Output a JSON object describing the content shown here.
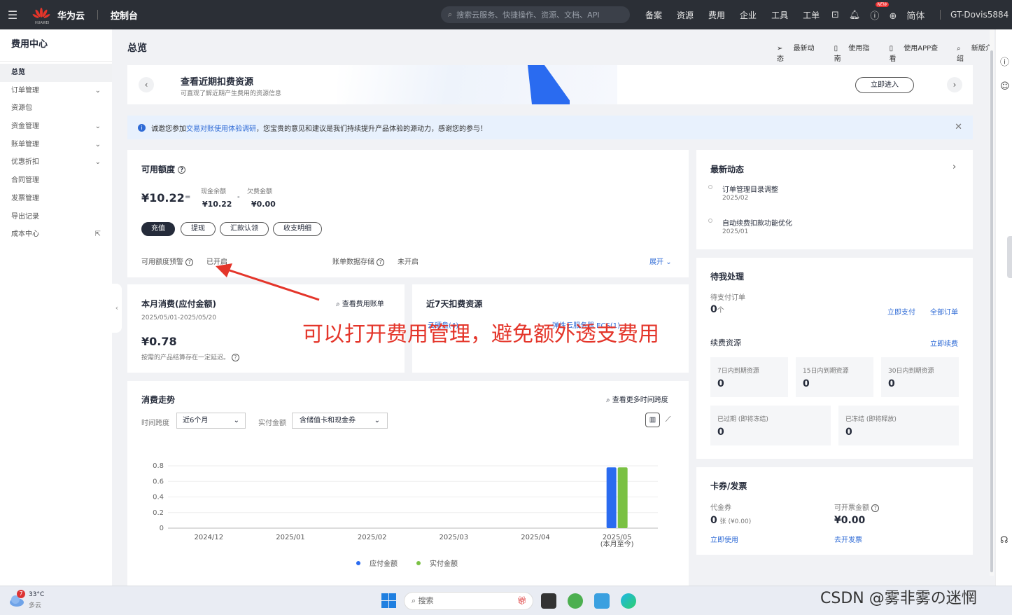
{
  "topbar": {
    "menu_icon": "hamburger-icon",
    "brand": "华为云",
    "brand_sub": "HUAWEI",
    "console": "控制台",
    "search_placeholder": "搜索云服务、快捷操作、资源、文档、API",
    "nav": [
      "备案",
      "资源",
      "费用",
      "企业",
      "工具",
      "工单"
    ],
    "new_badge": "NEW",
    "lang": "简体",
    "user": "GT-Dovis5884",
    "brand_color": "#e4352a"
  },
  "sidebar": {
    "title": "费用中心",
    "items": [
      {
        "label": "总览",
        "active": true,
        "expand": false
      },
      {
        "label": "订单管理",
        "expand": true
      },
      {
        "label": "资源包",
        "expand": false
      },
      {
        "label": "资金管理",
        "expand": true
      },
      {
        "label": "账单管理",
        "expand": true
      },
      {
        "label": "优惠折扣",
        "expand": true
      },
      {
        "label": "合同管理",
        "expand": false
      },
      {
        "label": "发票管理",
        "expand": false
      },
      {
        "label": "导出记录",
        "expand": false
      },
      {
        "label": "成本中心",
        "expand": false,
        "external": true
      }
    ]
  },
  "page": {
    "title": "总览",
    "top_links": [
      "最新动态",
      "使用指南",
      "使用APP查看",
      "新版介绍"
    ]
  },
  "banner": {
    "title": "查看近期扣费资源",
    "subtitle": "可直观了解近期产生费用的资源信息",
    "enter": "立即进入"
  },
  "notice": {
    "prefix": "诚邀您参加",
    "link": "交易对账使用体验调研",
    "suffix": "，您宝贵的意见和建议是我们持续提升产品体验的源动力，感谢您的参与！"
  },
  "balance": {
    "title": "可用额度",
    "amount": "¥10.22",
    "eq": "=",
    "minus": "-",
    "cash_label": "现金余额",
    "cash": "¥10.22",
    "debt_label": "欠费金额",
    "debt": "¥0.00",
    "buttons": [
      "充值",
      "提现",
      "汇款认领",
      "收支明细"
    ],
    "alert_label": "可用额度预警",
    "alert_status": "已开启",
    "storage_label": "账单数据存储",
    "storage_status": "未开启",
    "expand": "展开"
  },
  "monthly": {
    "title": "本月消费(应付金额)",
    "link": "查看费用账单",
    "period": "2025/05/01-2025/05/20",
    "amount": "¥0.78",
    "note": "按需的产品结算存在一定延迟。"
  },
  "recent7": {
    "title": "近7天扣费资源",
    "link1": "云硬盘(4)",
    "link2": "弹性云服务器 ECS(1)"
  },
  "annotation": "可以打开费用管理，避免额外透支费用",
  "trend": {
    "title": "消费走势",
    "more_link": "查看更多时间跨度",
    "span_label": "时间跨度",
    "span_value": "近6个月",
    "amount_label": "实付金额",
    "amount_value": "含储值卡和现金券",
    "legend": [
      "应付金额",
      "实付金额"
    ]
  },
  "chart_data": {
    "type": "bar",
    "categories": [
      "2024/12",
      "2025/01",
      "2025/02",
      "2025/03",
      "2025/04",
      "2025/05"
    ],
    "category_sub": [
      "",
      "",
      "",
      "",
      "",
      "(本月至今)"
    ],
    "series": [
      {
        "name": "应付金额",
        "values": [
          0,
          0,
          0,
          0,
          0,
          0.78
        ],
        "color": "#2a6bf0"
      },
      {
        "name": "实付金额",
        "values": [
          0,
          0,
          0,
          0,
          0,
          0.78
        ],
        "color": "#7ac143"
      }
    ],
    "yticks": [
      "0",
      "0.2",
      "0.4",
      "0.6",
      "0.8"
    ],
    "ylim": [
      0,
      0.8
    ],
    "grid": true,
    "legend_position": "bottom"
  },
  "news": {
    "title": "最新动态",
    "items": [
      {
        "title": "订单管理目录调整",
        "date": "2025/02"
      },
      {
        "title": "自动续费扣款功能优化",
        "date": "2025/01"
      }
    ]
  },
  "todo": {
    "title": "待我处理",
    "unpaid_label": "待支付订单",
    "unpaid_count": "0",
    "unpaid_unit": "个",
    "pay_now": "立即支付",
    "all_orders": "全部订单",
    "renew_label": "续费资源",
    "renew_now": "立即续费",
    "boxes": [
      {
        "label": "7日内到期资源",
        "value": "0"
      },
      {
        "label": "15日内到期资源",
        "value": "0"
      },
      {
        "label": "30日内到期资源",
        "value": "0"
      },
      {
        "label": "已过期 (即将冻结)",
        "value": "0"
      },
      {
        "label": "已冻结 (即将释放)",
        "value": "0"
      }
    ]
  },
  "coupons": {
    "title": "卡券/发票",
    "voucher_label": "代金券",
    "voucher_count": "0",
    "voucher_unit": "张 (¥0.00)",
    "use_now": "立即使用",
    "invoice_label": "可开票金额",
    "invoice_amount": "¥0.00",
    "invoice_link": "去开发票"
  },
  "taskbar": {
    "weather_temp": "33°C",
    "weather_desc": "多云",
    "weather_badge": "7",
    "search": "搜索"
  },
  "watermark": "CSDN @雾非雾の迷惘"
}
